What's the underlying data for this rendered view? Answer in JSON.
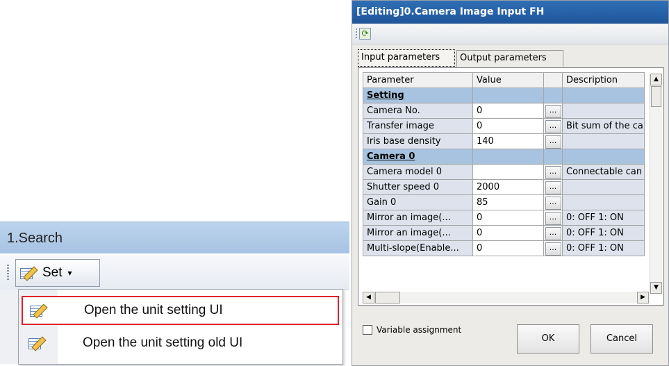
{
  "unit_panel": {
    "title": "1.Search",
    "set_button": {
      "label": "Set",
      "icon": "edit-icon",
      "caret": "▾"
    },
    "menu": [
      {
        "label": "Open the unit setting UI",
        "icon": "edit-icon",
        "highlighted": true
      },
      {
        "label": "Open the unit setting old UI",
        "icon": "edit-icon",
        "highlighted": false
      }
    ]
  },
  "dialog": {
    "title": "[Editing]0.Camera Image Input FH",
    "toolbar": {
      "refresh_icon": "refresh-icon"
    },
    "tabs": [
      {
        "label": "Input parameters",
        "active": true
      },
      {
        "label": "Output parameters",
        "active": false
      }
    ],
    "table": {
      "headers": [
        "Parameter",
        "Value",
        "",
        "Description"
      ],
      "rows": [
        {
          "type": "section",
          "parameter": "Setting"
        },
        {
          "type": "row",
          "parameter": "Camera No.",
          "value": "0",
          "button": "...",
          "description": ""
        },
        {
          "type": "row",
          "parameter": "Transfer image",
          "value": "0",
          "button": "...",
          "description": "Bit sum of the ca"
        },
        {
          "type": "row",
          "parameter": "Iris base density",
          "value": "140",
          "button": "...",
          "description": ""
        },
        {
          "type": "section",
          "parameter": "Camera 0"
        },
        {
          "type": "row",
          "parameter": "Camera model 0",
          "value": "",
          "button": "...",
          "description": "Connectable can"
        },
        {
          "type": "row",
          "parameter": "Shutter speed 0",
          "value": "2000",
          "button": "...",
          "description": ""
        },
        {
          "type": "row",
          "parameter": "Gain 0",
          "value": "85",
          "button": "...",
          "description": ""
        },
        {
          "type": "row",
          "parameter": "Mirror an image(...",
          "value": "0",
          "button": "...",
          "description": "0: OFF 1: ON"
        },
        {
          "type": "row",
          "parameter": "Mirror an image(...",
          "value": "0",
          "button": "...",
          "description": "0: OFF 1: ON"
        },
        {
          "type": "row",
          "parameter": "Multi-slope(Enable...",
          "value": "0",
          "button": "...",
          "description": "0: OFF 1: ON"
        }
      ]
    },
    "variable_assignment": {
      "label": "Variable assignment",
      "checked": false
    },
    "ok_label": "OK",
    "cancel_label": "Cancel"
  }
}
